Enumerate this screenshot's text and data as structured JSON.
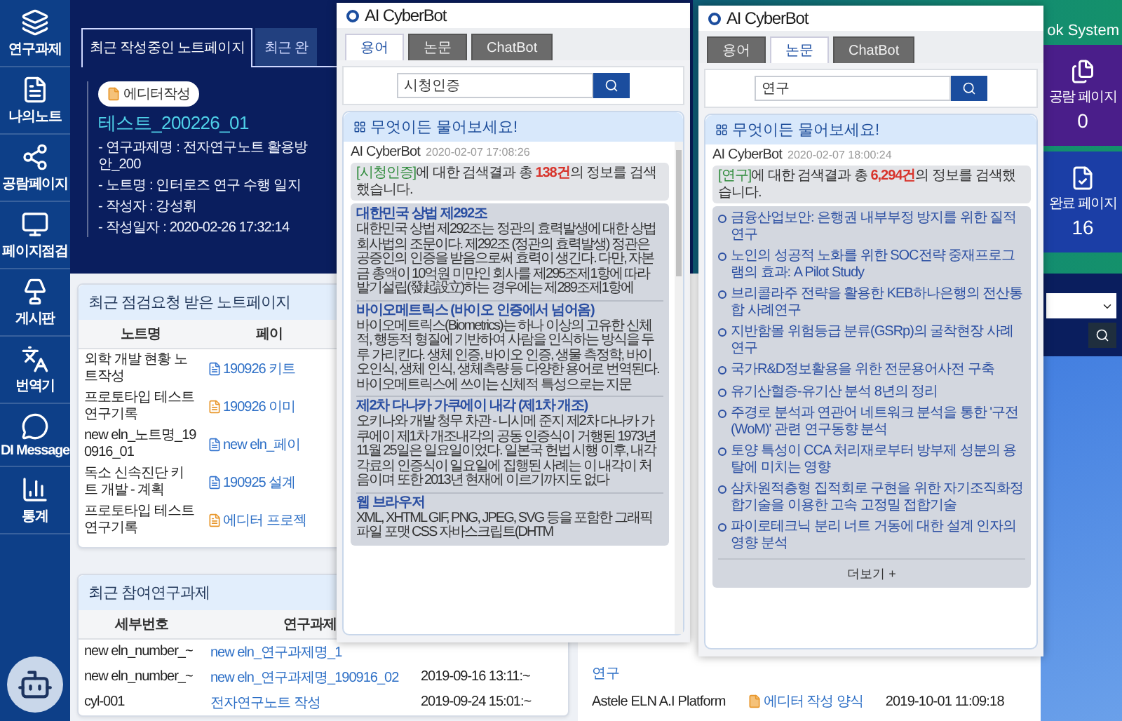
{
  "sidebar": {
    "items": [
      {
        "label": "연구과제"
      },
      {
        "label": "나의노트"
      },
      {
        "label": "공람페이지"
      },
      {
        "label": "페이지점검"
      },
      {
        "label": "게시판"
      },
      {
        "label": "번역기"
      },
      {
        "label": "DI Message"
      },
      {
        "label": "통계"
      }
    ]
  },
  "note_tabs": [
    {
      "label": "최근 작성중인 노트페이지",
      "selected": true
    },
    {
      "label": "최근 완",
      "selected": false
    }
  ],
  "note": {
    "badge": "에디터작성",
    "title": "테스트_200226_01",
    "details": [
      "- 연구과제명 : 전자연구노트 활용방안_200",
      "- 노트명 : 인터로즈 연구 수행 일지",
      "- 작성자 : 강성휘",
      "- 작성일자 : 2020-02-26 17:32:14"
    ]
  },
  "system": {
    "title": "ok System",
    "tiles": [
      {
        "label": "공람 페이지",
        "count": "0",
        "color": "#4a1e8a"
      },
      {
        "label": "완료 페이지",
        "count": "16",
        "color": "#1b3ea6"
      }
    ]
  },
  "review_panel": {
    "title": "최근 점검요청 받은 노트페이지",
    "columns": [
      "노트명",
      "페이"
    ],
    "rows": [
      {
        "note": "외학 개발 현황 노트작성",
        "page": "190926 키트",
        "color": "#3a78d0"
      },
      {
        "note": "프로토타입 테스트 연구기록",
        "page": "190926 이미",
        "color": "#e8962a"
      },
      {
        "note": "new eln_노트명_190916_01",
        "page": "new eln_페이",
        "color": "#3a78d0"
      },
      {
        "note": "독소 신속진단 키트 개발 - 계획",
        "page": "190925 설계",
        "color": "#3a78d0"
      },
      {
        "note": "프로토타입 테스트 연구기록",
        "page": "에디터 프로젝",
        "color": "#e8962a"
      }
    ]
  },
  "project_panel": {
    "title": "최근 참여연구과제",
    "columns": [
      "세부번호",
      "연구과제"
    ],
    "rows": [
      {
        "number": "new eln_number_~",
        "project": "new eln_연구과제명_1"
      },
      {
        "number": "new eln_number_~",
        "project": "new eln_연구과제명_190916_02",
        "date": "2019-09-16 13:11:~"
      },
      {
        "number": "cyl-001",
        "project": "전자연구노트 작성",
        "date": "2019-09-24 15:01:~"
      }
    ]
  },
  "middle_panel": {
    "heading": "연구",
    "platform": "Astele ELN A.I Platform",
    "form": "에디터 작성 양식",
    "date": "2019-10-01 11:09:18"
  },
  "popups": [
    {
      "title": "AI CyberBot",
      "tabs": [
        {
          "label": "용어",
          "selected": true
        },
        {
          "label": "논문",
          "selected": false
        },
        {
          "label": "ChatBot",
          "selected": false
        }
      ],
      "search": {
        "value": "시청인증"
      },
      "chat": {
        "title": "무엇이든 물어보세요!",
        "sender": "AI CyberBot",
        "time": "2020-02-07 17:08:26",
        "message": {
          "query": "[시청인증]",
          "before_count": "에 대한 검색결과 총 ",
          "count": "138건",
          "after_count": "의 정보를 검색했습니다."
        },
        "kind": "articles",
        "articles": [
          {
            "title": "대한민국 상법 제292조",
            "text": "대한민국 상법 제292조는 정관의 효력발생에 대한 상법 회사법의 조문이다. 제292조 (정관의 효력발생) 정관은 공증인의 인증을 받음으로써 효력이 생긴다. 다만, 자본금 총액이 10억원 미만인 회사를 제295조제1항에 따라 발기설립(發起設立)하는 경우에는 제289조제1항에"
          },
          {
            "title": "바이오메트릭스 (바이오 인증에서 넘어옴)",
            "text": "바이오메트릭스(Biometrics)는 하나 이상의 고유한 신체적, 행동적 형질에 기반하여 사람을 인식하는 방식을 두루 가리킨다. 생체 인증, 바이오 인증, 생물 측정학, 바이오인식, 생체 인식, 생체측량 등 다양한 용어로 번역된다. 바이오메트릭스에 쓰이는 신체적 특성으로는 지문"
          },
          {
            "title": "제2차 다나카 가쿠에이 내각 (제1차 개조)",
            "text": "오키나와 개발 청무 차관 - 니시메 준지 제2차 다나카 가쿠에이 제1차 개조내각의 공동 인증식이 거행된 1973년 11월 25일은 일요일이었다. 일본국 헌법 시행 이후, 내각 각료의 인증식이 일요일에 집행된 사례는 이 내각이 처음이며 또한 2013년 현재에 이르기까지도 없다"
          },
          {
            "title": "웹 브라우저",
            "text": "XML, XHTML GIF, PNG, JPEG, SVG 등을 포함한 그래픽 파일 포맷 CSS 자바스크립트(DHTM"
          }
        ]
      }
    },
    {
      "title": "AI CyberBot",
      "tabs": [
        {
          "label": "용어",
          "selected": false
        },
        {
          "label": "논문",
          "selected": true
        },
        {
          "label": "ChatBot",
          "selected": false
        }
      ],
      "search": {
        "value": "연구"
      },
      "chat": {
        "title": "무엇이든 물어보세요!",
        "sender": "AI CyberBot",
        "time": "2020-02-07 18:00:24",
        "message": {
          "query": "[연구]",
          "before_count": "에 대한 검색결과 총 ",
          "count": "6,294건",
          "after_count": "의 정보를 검색했습니다."
        },
        "kind": "links",
        "links": [
          "금융산업보안: 은행권 내부부정 방지를 위한 질적 연구",
          "노인의 성공적 노화를 위한 SOC전략 중재프로그램의 효과: A Pilot Study",
          "브리콜라주 전략을 활용한 KEB하나은행의 전산통합 사례연구",
          "지반함몰 위험등급 분류(GSRp)의 굴착현장 사례 연구",
          "국가R&D정보활용을 위한 전문용어사전 구축",
          "유기산혈증-유기산 분석 8년의 정리",
          "주경로 분석과 연관어 네트워크 분석을 통한 '구전(WoM)' 관련 연구동향 분석",
          "토양 특성이 CCA 처리재로부터 방부제 성분의 용탈에 미치는 영향",
          "삼차원적층형 집적회로 구현을 위한 자기조직화정합기술을 이용한 고속 고정밀 접합기술",
          "파이로테크닉 분리 너트 거동에 대한 설계 인자의 영향 분석"
        ],
        "more": "더보기 +"
      }
    }
  ]
}
